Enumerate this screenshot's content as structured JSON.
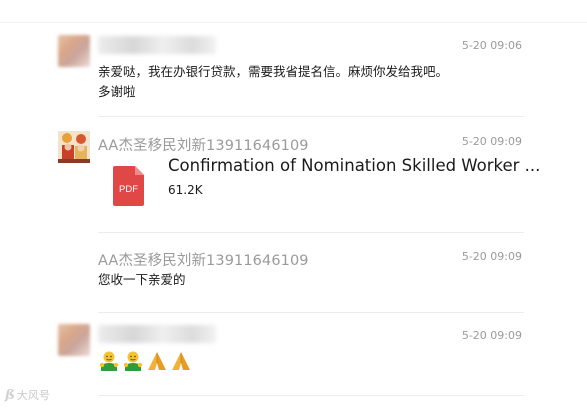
{
  "messages": [
    {
      "sender_blurred": true,
      "time": "5-20 09:06",
      "lines": [
        "亲爱哒，我在办银行贷款，需要我省提名信。麻烦你发给我吧。",
        "多谢啦"
      ]
    },
    {
      "sender": "AA杰圣移民刘新13911646109",
      "time": "5-20 09:09",
      "file": {
        "icon": "pdf-icon",
        "icon_label": "PDF",
        "name": "Confirmation of Nomination Skilled Worker ...",
        "size": "61.2K",
        "color": "#e04848"
      }
    },
    {
      "sender": "AA杰圣移民刘新13911646109",
      "time": "5-20 09:09",
      "lines": [
        "您收一下亲爱的"
      ]
    },
    {
      "sender_blurred": true,
      "time": "5-20 09:09",
      "emojis": [
        "hug-emoji",
        "hug-emoji",
        "pray-hands-emoji",
        "pray-hands-emoji"
      ]
    }
  ],
  "watermark": {
    "logo": "ß",
    "text": "大风号"
  },
  "colors": {
    "meta_text": "#9a9a9a",
    "divider": "#ececec",
    "pdf_red": "#e04848"
  }
}
